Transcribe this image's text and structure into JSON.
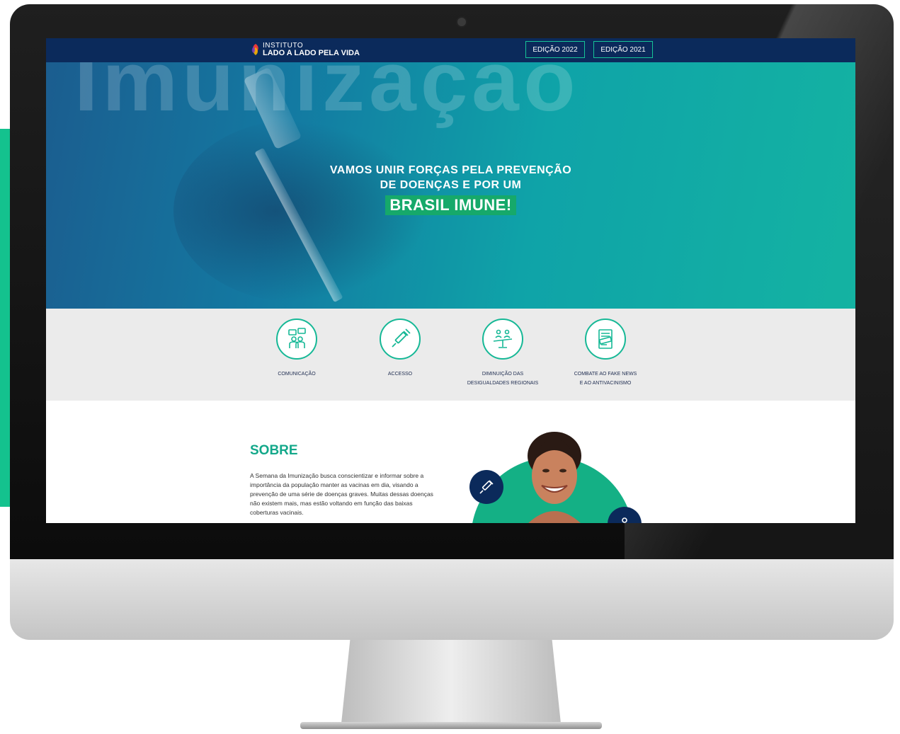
{
  "brand": {
    "logo_line1": "INSTITUTO",
    "logo_line2": "LADO A LADO PELA VIDA"
  },
  "nav": {
    "edition_2022": "EDIÇÃO 2022",
    "edition_2021": "EDIÇÃO 2021"
  },
  "hero": {
    "background_word": "Imunização",
    "line1": "VAMOS UNIR FORÇAS PELA PREVENÇÃO",
    "line2": "DE DOENÇAS E POR UM",
    "highlight": "BRASIL IMUNE!"
  },
  "pillars": [
    {
      "label_line1": "COMUNICAÇÃO",
      "label_line2": "",
      "icon": "communication-icon"
    },
    {
      "label_line1": "ACCESSO",
      "label_line2": "",
      "icon": "syringe-icon"
    },
    {
      "label_line1": "DIMINUIÇÃO DAS",
      "label_line2": "DESIGUALDADES REGIONAIS",
      "icon": "balance-scale-icon"
    },
    {
      "label_line1": "COMBATE AO FAKE NEWS",
      "label_line2": "E AO ANTIVACINISMO",
      "icon": "fake-news-icon"
    }
  ],
  "about": {
    "title": "SOBRE",
    "text": "A Semana da Imunização busca conscientizar e informar sobre a importância da população manter as vacinas em dia, visando a prevenção de uma série de doenças graves. Muitas dessas doenças não existem mais, mas estão voltando em função das baixas coberturas vacinais."
  },
  "colors": {
    "navy": "#0b2a5b",
    "accent_green": "#16b896",
    "highlight_green": "#16a96a",
    "panel_gray": "#ebebeb"
  }
}
